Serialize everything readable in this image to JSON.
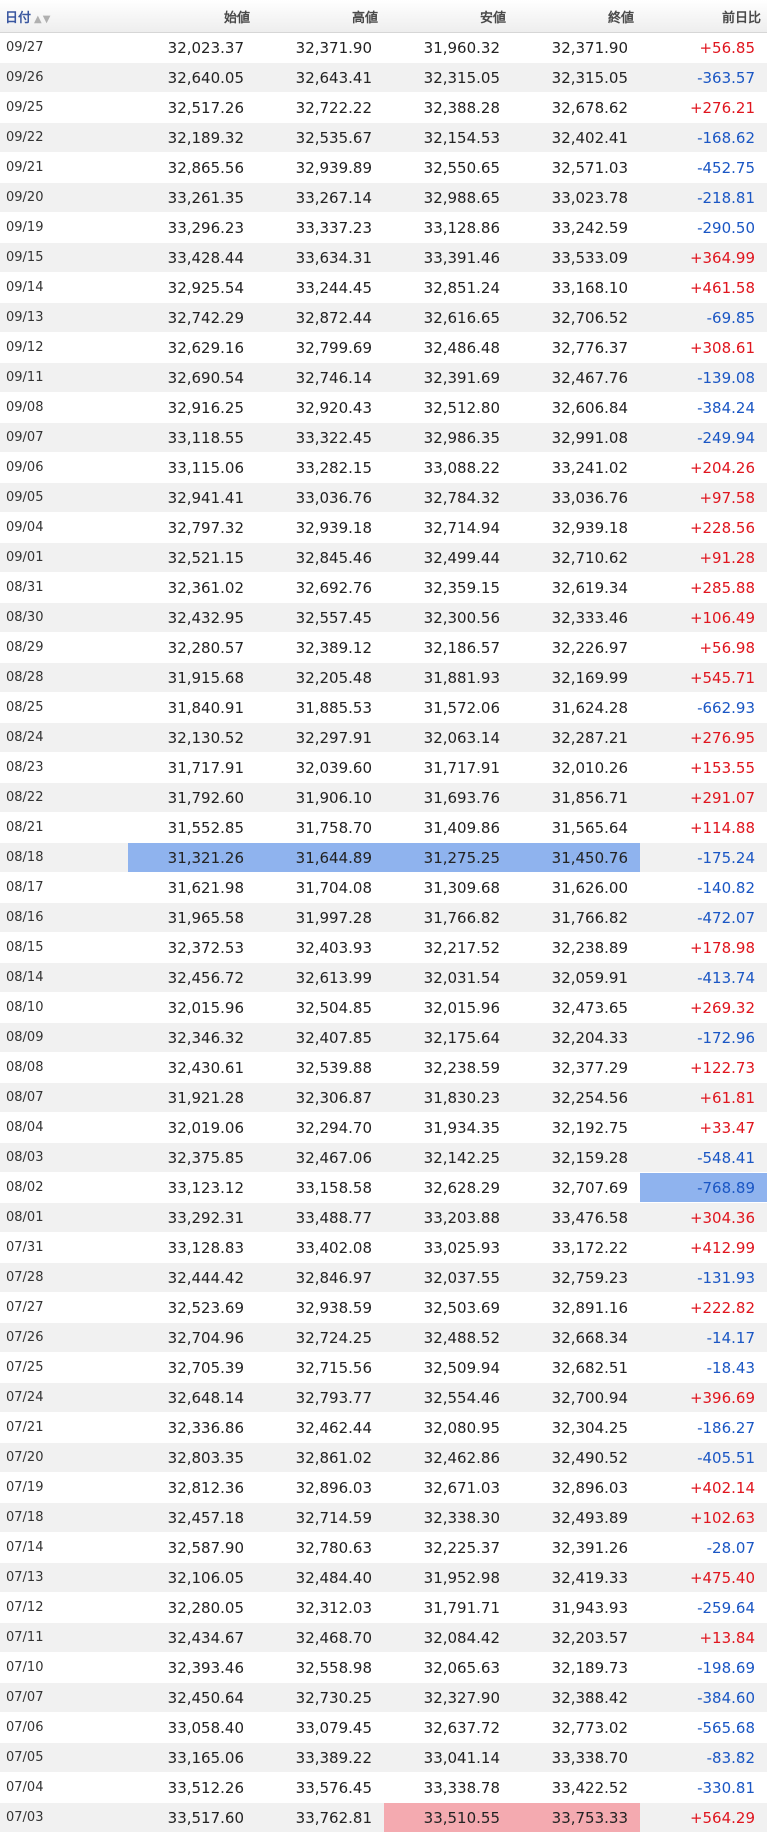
{
  "columns": {
    "date": "日付",
    "open": "始値",
    "high": "高値",
    "low": "安値",
    "close": "終値",
    "change": "前日比"
  },
  "sort_icons": "▲▼",
  "rows": [
    {
      "date": "09/27",
      "open": "32,023.37",
      "high": "32,371.90",
      "low": "31,960.32",
      "close": "32,371.90",
      "change": "+56.85"
    },
    {
      "date": "09/26",
      "open": "32,640.05",
      "high": "32,643.41",
      "low": "32,315.05",
      "close": "32,315.05",
      "change": "-363.57"
    },
    {
      "date": "09/25",
      "open": "32,517.26",
      "high": "32,722.22",
      "low": "32,388.28",
      "close": "32,678.62",
      "change": "+276.21"
    },
    {
      "date": "09/22",
      "open": "32,189.32",
      "high": "32,535.67",
      "low": "32,154.53",
      "close": "32,402.41",
      "change": "-168.62"
    },
    {
      "date": "09/21",
      "open": "32,865.56",
      "high": "32,939.89",
      "low": "32,550.65",
      "close": "32,571.03",
      "change": "-452.75"
    },
    {
      "date": "09/20",
      "open": "33,261.35",
      "high": "33,267.14",
      "low": "32,988.65",
      "close": "33,023.78",
      "change": "-218.81"
    },
    {
      "date": "09/19",
      "open": "33,296.23",
      "high": "33,337.23",
      "low": "33,128.86",
      "close": "33,242.59",
      "change": "-290.50"
    },
    {
      "date": "09/15",
      "open": "33,428.44",
      "high": "33,634.31",
      "low": "33,391.46",
      "close": "33,533.09",
      "change": "+364.99"
    },
    {
      "date": "09/14",
      "open": "32,925.54",
      "high": "33,244.45",
      "low": "32,851.24",
      "close": "33,168.10",
      "change": "+461.58"
    },
    {
      "date": "09/13",
      "open": "32,742.29",
      "high": "32,872.44",
      "low": "32,616.65",
      "close": "32,706.52",
      "change": "-69.85"
    },
    {
      "date": "09/12",
      "open": "32,629.16",
      "high": "32,799.69",
      "low": "32,486.48",
      "close": "32,776.37",
      "change": "+308.61"
    },
    {
      "date": "09/11",
      "open": "32,690.54",
      "high": "32,746.14",
      "low": "32,391.69",
      "close": "32,467.76",
      "change": "-139.08"
    },
    {
      "date": "09/08",
      "open": "32,916.25",
      "high": "32,920.43",
      "low": "32,512.80",
      "close": "32,606.84",
      "change": "-384.24"
    },
    {
      "date": "09/07",
      "open": "33,118.55",
      "high": "33,322.45",
      "low": "32,986.35",
      "close": "32,991.08",
      "change": "-249.94"
    },
    {
      "date": "09/06",
      "open": "33,115.06",
      "high": "33,282.15",
      "low": "33,088.22",
      "close": "33,241.02",
      "change": "+204.26"
    },
    {
      "date": "09/05",
      "open": "32,941.41",
      "high": "33,036.76",
      "low": "32,784.32",
      "close": "33,036.76",
      "change": "+97.58"
    },
    {
      "date": "09/04",
      "open": "32,797.32",
      "high": "32,939.18",
      "low": "32,714.94",
      "close": "32,939.18",
      "change": "+228.56"
    },
    {
      "date": "09/01",
      "open": "32,521.15",
      "high": "32,845.46",
      "low": "32,499.44",
      "close": "32,710.62",
      "change": "+91.28"
    },
    {
      "date": "08/31",
      "open": "32,361.02",
      "high": "32,692.76",
      "low": "32,359.15",
      "close": "32,619.34",
      "change": "+285.88"
    },
    {
      "date": "08/30",
      "open": "32,432.95",
      "high": "32,557.45",
      "low": "32,300.56",
      "close": "32,333.46",
      "change": "+106.49"
    },
    {
      "date": "08/29",
      "open": "32,280.57",
      "high": "32,389.12",
      "low": "32,186.57",
      "close": "32,226.97",
      "change": "+56.98"
    },
    {
      "date": "08/28",
      "open": "31,915.68",
      "high": "32,205.48",
      "low": "31,881.93",
      "close": "32,169.99",
      "change": "+545.71"
    },
    {
      "date": "08/25",
      "open": "31,840.91",
      "high": "31,885.53",
      "low": "31,572.06",
      "close": "31,624.28",
      "change": "-662.93"
    },
    {
      "date": "08/24",
      "open": "32,130.52",
      "high": "32,297.91",
      "low": "32,063.14",
      "close": "32,287.21",
      "change": "+276.95"
    },
    {
      "date": "08/23",
      "open": "31,717.91",
      "high": "32,039.60",
      "low": "31,717.91",
      "close": "32,010.26",
      "change": "+153.55"
    },
    {
      "date": "08/22",
      "open": "31,792.60",
      "high": "31,906.10",
      "low": "31,693.76",
      "close": "31,856.71",
      "change": "+291.07"
    },
    {
      "date": "08/21",
      "open": "31,552.85",
      "high": "31,758.70",
      "low": "31,409.86",
      "close": "31,565.64",
      "change": "+114.88"
    },
    {
      "date": "08/18",
      "open": "31,321.26",
      "high": "31,644.89",
      "low": "31,275.25",
      "close": "31,450.76",
      "change": "-175.24",
      "hl": {
        "open": "blue",
        "high": "blue",
        "low": "blue",
        "close": "blue"
      }
    },
    {
      "date": "08/17",
      "open": "31,621.98",
      "high": "31,704.08",
      "low": "31,309.68",
      "close": "31,626.00",
      "change": "-140.82"
    },
    {
      "date": "08/16",
      "open": "31,965.58",
      "high": "31,997.28",
      "low": "31,766.82",
      "close": "31,766.82",
      "change": "-472.07"
    },
    {
      "date": "08/15",
      "open": "32,372.53",
      "high": "32,403.93",
      "low": "32,217.52",
      "close": "32,238.89",
      "change": "+178.98"
    },
    {
      "date": "08/14",
      "open": "32,456.72",
      "high": "32,613.99",
      "low": "32,031.54",
      "close": "32,059.91",
      "change": "-413.74"
    },
    {
      "date": "08/10",
      "open": "32,015.96",
      "high": "32,504.85",
      "low": "32,015.96",
      "close": "32,473.65",
      "change": "+269.32"
    },
    {
      "date": "08/09",
      "open": "32,346.32",
      "high": "32,407.85",
      "low": "32,175.64",
      "close": "32,204.33",
      "change": "-172.96"
    },
    {
      "date": "08/08",
      "open": "32,430.61",
      "high": "32,539.88",
      "low": "32,238.59",
      "close": "32,377.29",
      "change": "+122.73"
    },
    {
      "date": "08/07",
      "open": "31,921.28",
      "high": "32,306.87",
      "low": "31,830.23",
      "close": "32,254.56",
      "change": "+61.81"
    },
    {
      "date": "08/04",
      "open": "32,019.06",
      "high": "32,294.70",
      "low": "31,934.35",
      "close": "32,192.75",
      "change": "+33.47"
    },
    {
      "date": "08/03",
      "open": "32,375.85",
      "high": "32,467.06",
      "low": "32,142.25",
      "close": "32,159.28",
      "change": "-548.41"
    },
    {
      "date": "08/02",
      "open": "33,123.12",
      "high": "33,158.58",
      "low": "32,628.29",
      "close": "32,707.69",
      "change": "-768.89",
      "hl": {
        "change": "blue"
      }
    },
    {
      "date": "08/01",
      "open": "33,292.31",
      "high": "33,488.77",
      "low": "33,203.88",
      "close": "33,476.58",
      "change": "+304.36"
    },
    {
      "date": "07/31",
      "open": "33,128.83",
      "high": "33,402.08",
      "low": "33,025.93",
      "close": "33,172.22",
      "change": "+412.99"
    },
    {
      "date": "07/28",
      "open": "32,444.42",
      "high": "32,846.97",
      "low": "32,037.55",
      "close": "32,759.23",
      "change": "-131.93"
    },
    {
      "date": "07/27",
      "open": "32,523.69",
      "high": "32,938.59",
      "low": "32,503.69",
      "close": "32,891.16",
      "change": "+222.82"
    },
    {
      "date": "07/26",
      "open": "32,704.96",
      "high": "32,724.25",
      "low": "32,488.52",
      "close": "32,668.34",
      "change": "-14.17"
    },
    {
      "date": "07/25",
      "open": "32,705.39",
      "high": "32,715.56",
      "low": "32,509.94",
      "close": "32,682.51",
      "change": "-18.43"
    },
    {
      "date": "07/24",
      "open": "32,648.14",
      "high": "32,793.77",
      "low": "32,554.46",
      "close": "32,700.94",
      "change": "+396.69"
    },
    {
      "date": "07/21",
      "open": "32,336.86",
      "high": "32,462.44",
      "low": "32,080.95",
      "close": "32,304.25",
      "change": "-186.27"
    },
    {
      "date": "07/20",
      "open": "32,803.35",
      "high": "32,861.02",
      "low": "32,462.86",
      "close": "32,490.52",
      "change": "-405.51"
    },
    {
      "date": "07/19",
      "open": "32,812.36",
      "high": "32,896.03",
      "low": "32,671.03",
      "close": "32,896.03",
      "change": "+402.14"
    },
    {
      "date": "07/18",
      "open": "32,457.18",
      "high": "32,714.59",
      "low": "32,338.30",
      "close": "32,493.89",
      "change": "+102.63"
    },
    {
      "date": "07/14",
      "open": "32,587.90",
      "high": "32,780.63",
      "low": "32,225.37",
      "close": "32,391.26",
      "change": "-28.07"
    },
    {
      "date": "07/13",
      "open": "32,106.05",
      "high": "32,484.40",
      "low": "31,952.98",
      "close": "32,419.33",
      "change": "+475.40"
    },
    {
      "date": "07/12",
      "open": "32,280.05",
      "high": "32,312.03",
      "low": "31,791.71",
      "close": "31,943.93",
      "change": "-259.64"
    },
    {
      "date": "07/11",
      "open": "32,434.67",
      "high": "32,468.70",
      "low": "32,084.42",
      "close": "32,203.57",
      "change": "+13.84"
    },
    {
      "date": "07/10",
      "open": "32,393.46",
      "high": "32,558.98",
      "low": "32,065.63",
      "close": "32,189.73",
      "change": "-198.69"
    },
    {
      "date": "07/07",
      "open": "32,450.64",
      "high": "32,730.25",
      "low": "32,327.90",
      "close": "32,388.42",
      "change": "-384.60"
    },
    {
      "date": "07/06",
      "open": "33,058.40",
      "high": "33,079.45",
      "low": "32,637.72",
      "close": "32,773.02",
      "change": "-565.68"
    },
    {
      "date": "07/05",
      "open": "33,165.06",
      "high": "33,389.22",
      "low": "33,041.14",
      "close": "33,338.70",
      "change": "-83.82"
    },
    {
      "date": "07/04",
      "open": "33,512.26",
      "high": "33,576.45",
      "low": "33,338.78",
      "close": "33,422.52",
      "change": "-330.81"
    },
    {
      "date": "07/03",
      "open": "33,517.60",
      "high": "33,762.81",
      "low": "33,510.55",
      "close": "33,753.33",
      "change": "+564.29",
      "hl": {
        "low": "red",
        "close": "red"
      }
    }
  ],
  "colors": {
    "positive": "#e0151e",
    "negative": "#1a56c4",
    "highlight_blue": "#8fb3ee",
    "highlight_red": "#f4aab0"
  }
}
